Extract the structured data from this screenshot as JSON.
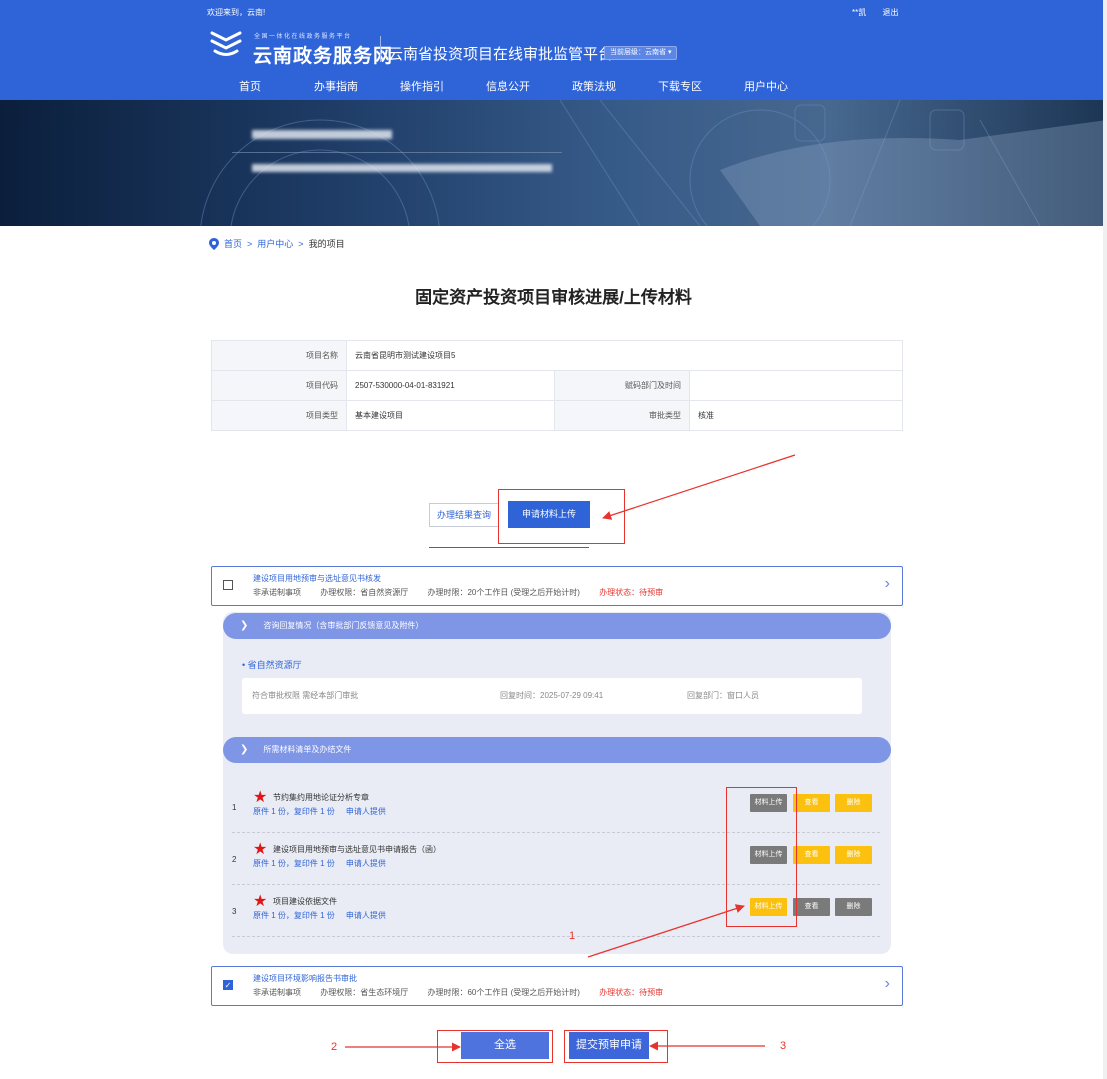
{
  "header": {
    "welcome": "欢迎来到，云南!",
    "user_name": "**凯",
    "logout": "退出",
    "logo_small": "全国一体化在线政务服务平台",
    "logo_title": "云南政务服务网",
    "platform_name": "云南省投资项目在线审批监管平台",
    "level_badge": "当前层级：云南省 ▾",
    "nav": [
      "首页",
      "办事指南",
      "操作指引",
      "信息公开",
      "政策法规",
      "下载专区",
      "用户中心"
    ]
  },
  "breadcrumb": {
    "home": "首页",
    "sep": ">",
    "user_center": "用户中心",
    "current": "我的项目"
  },
  "page_title": "固定资产投资项目审核进展/上传材料",
  "project_info": {
    "name_label": "项目名称",
    "name": "云南省昆明市测试建设项目5",
    "code_label": "项目代码",
    "code": "2507-530000-04-01-831921",
    "dept_label": "赋码部门及时间",
    "dept": "",
    "type_label": "项目类型",
    "type": "基本建设项目",
    "approval_label": "审批类型",
    "approval": "核准"
  },
  "tabs": {
    "result": "办理结果查询",
    "upload": "申请材料上传"
  },
  "items": [
    {
      "title": "建设项目用地预审与选址意见书核发",
      "kind": "非承诺制事项",
      "authority": "办理权限：省自然资源厅",
      "time_limit": "办理时限：20个工作日 (受理之后开始计时)",
      "status_label": "办理状态：",
      "status": "待预审",
      "checked": false
    },
    {
      "title": "建设项目环境影响报告书审批",
      "kind": "非承诺制事项",
      "authority": "办理权限：省生态环境厅",
      "time_limit": "办理时限：60个工作日 (受理之后开始计时)",
      "status_label": "办理状态：",
      "status": "待预审",
      "checked": true
    }
  ],
  "reply_section": {
    "header": "咨询回复情况（含审批部门反馈意见及附件）",
    "org": "省自然资源厅",
    "content": "符合审批权限 需经本部门审批",
    "reply_time": "回复时间：2025-07-29 09:41",
    "reply_dept": "回复部门：窗口人员"
  },
  "materials_section": {
    "header": "所需材料清单及办结文件",
    "rows": [
      {
        "index": "1",
        "name": "节约集约用地论证分析专章",
        "copies": "原件 1 份，复印件 1 份",
        "provider": "申请人提供"
      },
      {
        "index": "2",
        "name": "建设项目用地预审与选址意见书申请报告（函）",
        "copies": "原件 1 份，复印件 1 份",
        "provider": "申请人提供"
      },
      {
        "index": "3",
        "name": "项目建设依据文件",
        "copies": "原件 1 份，复印件 1 份",
        "provider": "申请人提供"
      }
    ],
    "upload_label": "材料上传",
    "view_label": "查看",
    "delete_label": "删除"
  },
  "actions": {
    "select_all": "全选",
    "submit": "提交预审申请"
  },
  "annotations": {
    "one": "1",
    "two": "2",
    "three": "3"
  },
  "colors": {
    "primary": "#2f64d8",
    "accent_red": "#e7332d",
    "button_yellow": "#fcc10f",
    "button_gray": "#7a7a7a",
    "section_header": "#7f95e6"
  }
}
